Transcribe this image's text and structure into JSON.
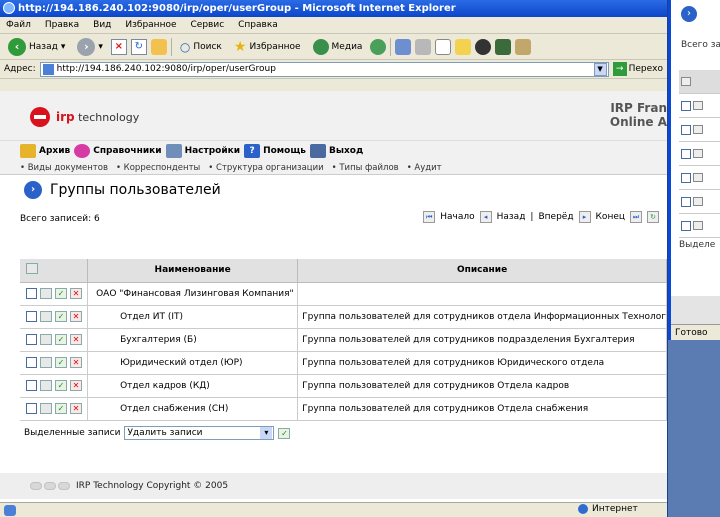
{
  "browser": {
    "window_title": "http://194.186.240.102:9080/irp/oper/userGroup - Microsoft Internet Explorer",
    "menu": [
      "Файл",
      "Правка",
      "Вид",
      "Избранное",
      "Сервис",
      "Справка"
    ],
    "toolbar": {
      "back": "Назад",
      "search": "Поиск",
      "favorites": "Избранное",
      "media": "Медиа"
    },
    "address_label": "Адрес:",
    "address_value": "http://194.186.240.102:9080/irp/oper/userGroup",
    "go_label": "Перехо"
  },
  "site": {
    "logo_text_brand": "irp",
    "logo_text_rest": " technology",
    "title_line1": "IRP Fran",
    "title_line2": "Online A",
    "main_menu": [
      "Архив",
      "Справочники",
      "Настройки",
      "Помощь",
      "Выход"
    ],
    "sub_menu": [
      "• Виды документов",
      "• Корреспонденты",
      "• Структура организации",
      "• Типы файлов",
      "• Аудит"
    ]
  },
  "page": {
    "title": "Группы пользователей",
    "records_label": "Всего записей: 6",
    "pager": {
      "first": "Начало",
      "prev": "Назад",
      "separator": "|",
      "next": "Вперёд",
      "last": "Конец"
    },
    "columns": {
      "name": "Наименование",
      "description": "Описание"
    },
    "rows": [
      {
        "name": "ОАО \"Финансовая Лизинговая Компания\"",
        "description": ""
      },
      {
        "name": "Отдел ИТ (IT)",
        "description": "Группа пользователей для сотрудников отдела Информационных Технолог"
      },
      {
        "name": "Бухгалтерия (Б)",
        "description": "Группа пользователей для сотрудников подразделения Бухгалтерия"
      },
      {
        "name": "Юридический отдел (ЮР)",
        "description": "Группа пользователей для сотрудников Юридического отдела"
      },
      {
        "name": "Отдел кадров (КД)",
        "description": "Группа пользователей для сотрудников Отдела кадров"
      },
      {
        "name": "Отдел снабжения (СН)",
        "description": "Группа пользователей для сотрудников Отдела снабжения"
      }
    ],
    "selected_label": "Выделенные записи",
    "selected_action": "Удалить записи",
    "footer": "IRP Technology Copyright © 2005"
  },
  "status": {
    "zone": "Интернет"
  },
  "background_window": {
    "records_fragment": "Всего за",
    "selected_fragment": "Выделе",
    "status": "Готово"
  },
  "colors": {
    "titlebar": "#0b46c9",
    "accent_red": "#d8131b",
    "link_blue": "#2a62c9"
  }
}
